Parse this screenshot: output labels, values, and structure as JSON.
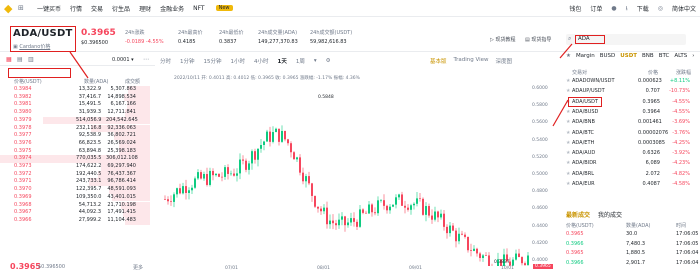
{
  "topnav": {
    "items": [
      "一键买币",
      "行情",
      "交易",
      "衍生品",
      "理财",
      "金融业务",
      "NFT"
    ],
    "new_badge": "New",
    "right": [
      "钱包",
      "订单",
      "下载",
      "简体中文"
    ]
  },
  "header": {
    "symbol": "ADA/USDT",
    "symbol_sub": "Cardano价格",
    "last_price": "0.3965",
    "last_price_usd": "$0.396500",
    "stats": [
      {
        "label": "24h涨跌",
        "value": "-0.0189 -4.55%"
      },
      {
        "label": "24h最高价",
        "value": "0.4185"
      },
      {
        "label": "24h最低价",
        "value": "0.3837"
      },
      {
        "label": "24h成交量(ADA)",
        "value": "149,277,370.83"
      },
      {
        "label": "24h成交额(USDT)",
        "value": "59,982,616.83"
      }
    ],
    "right_links": [
      "现货教程",
      "现货指导"
    ]
  },
  "orderbook": {
    "precision": "0.0001",
    "col_price": "价格(USDT)",
    "col_amount": "数量(ADA)",
    "col_total": "成交额",
    "rows": [
      {
        "p": "0.3984",
        "a": "13,322.9",
        "t": "5,307.863"
      },
      {
        "p": "0.3982",
        "a": "37,416.7",
        "t": "14,898.534"
      },
      {
        "p": "0.3981",
        "a": "15,491.5",
        "t": "6,167.166"
      },
      {
        "p": "0.3980",
        "a": "31,939.3",
        "t": "12,711.841"
      },
      {
        "p": "0.3979",
        "a": "514,056.9",
        "t": "204,542.645"
      },
      {
        "p": "0.3978",
        "a": "232,116.8",
        "t": "92,336.063"
      },
      {
        "p": "0.3977",
        "a": "92,538.9",
        "t": "36,802.721"
      },
      {
        "p": "0.3976",
        "a": "66,823.5",
        "t": "26,569.024"
      },
      {
        "p": "0.3975",
        "a": "63,894.8",
        "t": "25,398.183"
      },
      {
        "p": "0.3974",
        "a": "770,035.5",
        "t": "306,012.108"
      },
      {
        "p": "0.3973",
        "a": "174,622.2",
        "t": "69,297.940"
      },
      {
        "p": "0.3972",
        "a": "192,440.5",
        "t": "76,437.367"
      },
      {
        "p": "0.3971",
        "a": "243,733.1",
        "t": "96,786.414"
      },
      {
        "p": "0.3970",
        "a": "122,395.7",
        "t": "48,591.093"
      },
      {
        "p": "0.3969",
        "a": "109,350.0",
        "t": "43,401.015"
      },
      {
        "p": "0.3968",
        "a": "54,713.2",
        "t": "21,710.198"
      },
      {
        "p": "0.3967",
        "a": "44,092.3",
        "t": "17,491.415"
      },
      {
        "p": "0.3966",
        "a": "27,999.2",
        "t": "11,104.483"
      }
    ],
    "last": "0.3965",
    "last_usd": "$0.396500",
    "more": "更多"
  },
  "chart": {
    "tabs": [
      "分时",
      "1分钟",
      "15分钟",
      "1小时",
      "4小时",
      "1天",
      "1周"
    ],
    "right_tabs": [
      "基本版",
      "Trading View",
      "深度图"
    ],
    "info": "2022/10/11 开: 0.4011 高: 0.4012 低: 0.3965 收: 0.3965 涨跌幅: -1.17% 振幅: 4.36%",
    "high_label": "0.5848",
    "low_label": "0.3837",
    "current_label": "0.3965",
    "y_ticks": [
      "0.6000",
      "0.5800",
      "0.5600",
      "0.5400",
      "0.5200",
      "0.5000",
      "0.4800",
      "0.4600",
      "0.4400",
      "0.4200",
      "0.4000"
    ],
    "x_ticks": [
      "07/01",
      "08/01",
      "09/01",
      "10/01"
    ]
  },
  "markets": {
    "search_value": "ADA",
    "tabs": [
      "Margin",
      "BUSD",
      "USDT",
      "BNB",
      "BTC",
      "ALTS"
    ],
    "col_pair": "交易对",
    "col_price": "价格",
    "col_change": "涨跌幅",
    "rows": [
      {
        "pair": "ADADOWN/USDT",
        "price": "0.000623",
        "change": "+8.11%",
        "up": true
      },
      {
        "pair": "ADAUP/USDT",
        "price": "0.707",
        "change": "-10.73%",
        "up": false
      },
      {
        "pair": "ADA/USDT",
        "price": "0.3965",
        "change": "-4.55%",
        "up": false
      },
      {
        "pair": "ADA/BUSD",
        "price": "0.3964",
        "change": "-4.55%",
        "up": false
      },
      {
        "pair": "ADA/BNB",
        "price": "0.001461",
        "change": "-3.69%",
        "up": false
      },
      {
        "pair": "ADA/BTC",
        "price": "0.00002076",
        "change": "-3.76%",
        "up": false
      },
      {
        "pair": "ADA/ETH",
        "price": "0.0003085",
        "change": "-4.25%",
        "up": false
      },
      {
        "pair": "ADA/AUD",
        "price": "0.6326",
        "change": "-3.92%",
        "up": false
      },
      {
        "pair": "ADA/BIDR",
        "price": "6,089",
        "change": "-4.23%",
        "up": false
      },
      {
        "pair": "ADA/BRL",
        "price": "2.072",
        "change": "-4.82%",
        "up": false
      },
      {
        "pair": "ADA/EUR",
        "price": "0.4087",
        "change": "-4.58%",
        "up": false
      }
    ]
  },
  "trades": {
    "tabs": [
      "最新成交",
      "我的成交"
    ],
    "col_price": "价格(USDT)",
    "col_amount": "数量(ADA)",
    "col_time": "时间",
    "rows": [
      {
        "p": "0.3965",
        "a": "30.0",
        "t": "17:06:05"
      },
      {
        "p": "0.3966",
        "a": "7,480.3",
        "t": "17:06:05"
      },
      {
        "p": "0.3965",
        "a": "1,880.5",
        "t": "17:06:04"
      },
      {
        "p": "0.3966",
        "a": "2,901.7",
        "t": "17:06:04"
      }
    ]
  },
  "colors": {
    "up": "#0ecb81",
    "down": "#f6465d",
    "accent": "#f0b90b",
    "annotation": "#e02020"
  }
}
